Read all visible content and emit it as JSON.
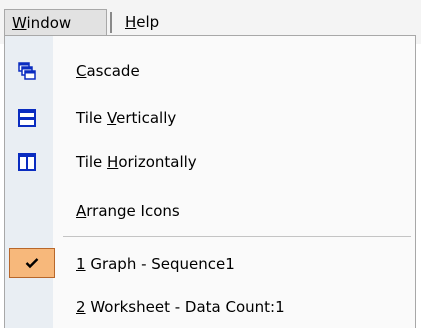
{
  "menubar": {
    "window_label_mnemonic": "W",
    "window_label_rest": "indow",
    "help_label_mnemonic": "H",
    "help_label_rest": "elp"
  },
  "window_menu": {
    "items": [
      {
        "mnemonic": "C",
        "rest": "ascade",
        "icon": "cascade-windows-icon"
      },
      {
        "prefix": "Tile ",
        "mnemonic": "V",
        "rest": "ertically",
        "icon": "tile-vertically-icon"
      },
      {
        "prefix": "Tile ",
        "mnemonic": "H",
        "rest": "orizontally",
        "icon": "tile-horizontally-icon"
      },
      {
        "mnemonic": "A",
        "rest": "rrange Icons"
      }
    ],
    "windows": [
      {
        "mnemonic": "1",
        "rest": " Graph - Sequence1",
        "checked": true
      },
      {
        "mnemonic": "2",
        "rest": " Worksheet - Data Count:1",
        "checked": false
      }
    ]
  },
  "colors": {
    "icon_blue": "#0a2cc0",
    "check_highlight": "#f7b87b",
    "icon_strip": "#e9eef3"
  }
}
